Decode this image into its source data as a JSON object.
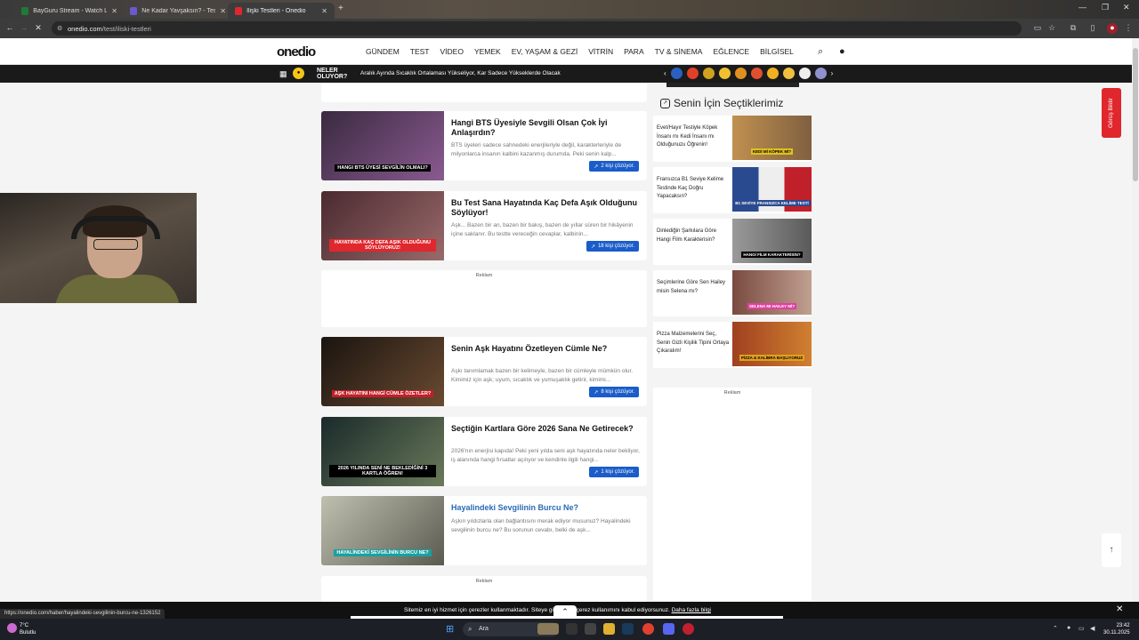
{
  "browser": {
    "tabs": [
      {
        "label": "BayGuru Stream - Watch Live o",
        "color": "#1f7a3a"
      },
      {
        "label": "Ne Kadar Yavşaksın? - Test",
        "color": "#6a5acd"
      },
      {
        "label": "İlişki Testleri - Onedio",
        "color": "#e0272d"
      }
    ],
    "url_host": "onedio.com",
    "url_path": "/test/iliski-testleri"
  },
  "header": {
    "logo": "onedio",
    "nav": [
      "GÜNDEM",
      "TEST",
      "VİDEO",
      "YEMEK",
      "EV, YAŞAM & GEZİ",
      "VİTRİN",
      "PARA",
      "TV & SİNEMA",
      "EĞLENCE",
      "BİLGİSEL"
    ],
    "search_icon": "search-icon",
    "user_icon": "user-icon"
  },
  "newsbar": {
    "badge_line1": "NELER",
    "badge_line2": "OLUYOR?",
    "ticker": "Aralık Ayında Sıcaklık Ortalaması Yükseliyor, Kar Sadece Yükseklerde Olacak"
  },
  "cards": [
    {
      "title": "Hangi BTS Üyesiyle Sevgili Olsan Çok İyi Anlaşırdın?",
      "desc": "BTS üyeleri sadece sahnedeki enerjileriyle değil, karakterleriyle de milyonlarca insanın kalbini kazanmış durumda. Peki senin kalp...",
      "badge": "2 kişi çözüyor.",
      "thumb_caption": "HANGI BTS ÜYESİ SEVGİLİN OLMALI?",
      "thumb_color": "#7a4a80"
    },
    {
      "title": "Bu Test Sana Hayatında Kaç Defa Aşık Olduğunu Söylüyor!",
      "desc": "Aşk... Bazen bir an, bazen bir bakış, bazen de yıllar süren bir hikâyenin içine saklanır. Bu testte vereceğin cevaplar, kalbinin...",
      "badge": "18 kişi çözüyor.",
      "thumb_caption": "HAYATINDA KAÇ DEFA AŞIK OLDUĞUNU SÖYLÜYORUZ!",
      "thumb_color": "#5a3a42"
    },
    {
      "title": "Senin Aşk Hayatını Özetleyen Cümle Ne?",
      "desc": "Aşkı tanımlamak bazen bir kelimeyle, bazen bir cümleyle mümkün olur. Kimimiz için aşk; uyum, sıcaklık ve yumuşaklık getirir, kimimi...",
      "badge": "8 kişi çözüyor.",
      "thumb_caption": "AŞK HAYATINI HANGİ CÜMLE ÖZETLER?",
      "thumb_color": "#3a2a22"
    },
    {
      "title": "Seçtiğin Kartlara Göre 2026 Sana Ne Getirecek?",
      "desc": "2026'nın enerjisi kapıda! Peki yeni yılda seni aşk hayatında neler bekliyor, iş alanında hangi fırsatlar açılıyor ve kendinle ilgili hangi...",
      "badge": "1 kişi çözüyor.",
      "thumb_caption": "2026 YILINDA SENİ NE BEKLEDİĞİNİ 3 KARTLA ÖĞREN!",
      "thumb_color": "#2a3a3a"
    },
    {
      "title": "Hayalindeki Sevgilinin Burcu Ne?",
      "desc": "Aşkın yıldızlarla olan bağlantısını merak ediyor musunuz? Hayalindeki sevgilinin burcu ne? Bu sorunun cevabı, belki de aşk...",
      "badge": "",
      "thumb_caption": "HAYALİNDEKİ SEVGİLİNİN BURCU NE?",
      "thumb_color": "#8a8a7a"
    }
  ],
  "ad_label": "Reklam",
  "sidebar": {
    "title": "Senin İçin Seçtiklerimiz",
    "items": [
      {
        "text": "Evet/Hayır Testiyle Köpek İnsanı mı Kedi İnsanı mı Olduğunuzu Öğrenin!",
        "caption": "KEDİ Mİ KÖPEK Mİ?",
        "color": "#b08040"
      },
      {
        "text": "Fransızca B1 Seviye Kelime Testinde Kaç Doğru Yapacaksın?",
        "caption": "B1 SEVİYE FRANSIZCA KELİME TESTİ",
        "color": "#506080"
      },
      {
        "text": "Dinlediğin Şarkılara Göre Hangi Film Karakterisin?",
        "caption": "HANGİ FİLM KARAKTERİSİN?",
        "color": "#808080"
      },
      {
        "text": "Seçimlerine Göre Sen Hailey misin Selena mı?",
        "caption": "SELENA MI HAILEY Mİ?",
        "color": "#a07060"
      },
      {
        "text": "Pizza Malzemelerini Seç, Senin Gizli Kişilik Tipini Ortaya Çıkaralım!",
        "caption": "PİZZA & KALİBRA BAŞLIYORUZ",
        "color": "#904020"
      }
    ]
  },
  "feedback_label": "Görüş Bildir",
  "status_url": "https://onedio.com/haber/hayalindeki-sevgilinin-burcu-ne-1326152",
  "cookie": {
    "msg_a": "Sitemiz en iyi hizmet için çerezler kullanmaktadır. Siteye gi",
    "msg_b": "çerez kullanımını kabul ediyorsunuz.",
    "more": "Daha fazla bilgi"
  },
  "taskbar": {
    "temp": "7°C",
    "weather": "Bulutlu",
    "search": "Ara",
    "time": "23:42",
    "date": "30.11.2025"
  }
}
